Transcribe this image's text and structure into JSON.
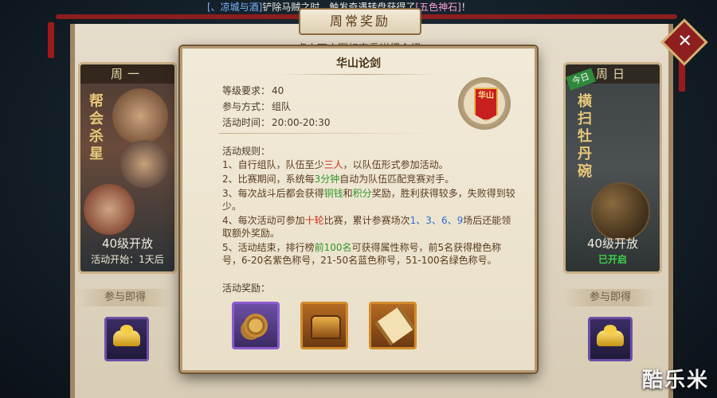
{
  "ticker": {
    "link": "[、凉城与酒]",
    "text": "铲除马贼之时，触发奇遇转盘获得了",
    "item": "[五色神石]",
    "end": "！"
  },
  "board": {
    "title": "周常奖励",
    "hint": "点击下方图标查看详细介绍",
    "close_label": "✕"
  },
  "left_card": {
    "day": "周一",
    "activity_vertical": "帮会杀星",
    "level": "40级开放",
    "sub": "活动开始：1天后",
    "join_label": "参与即得"
  },
  "right_card": {
    "badge": "今日",
    "day": "周日",
    "activity_vertical": "横扫牡丹碗",
    "level": "40级开放",
    "sub": "已开启",
    "join_label": "参与即得"
  },
  "dialog": {
    "title": "华山论剑",
    "level_key": "等级要求：",
    "level_val": "40",
    "mode_key": "参与方式：",
    "mode_val": "组队",
    "time_key": "活动时间：",
    "time_val": "20:00-20:30",
    "emblem_text": "华山",
    "rules_head": "活动规则：",
    "rules": {
      "r1a": "1、自行组队，队伍至少",
      "r1b": "三人",
      "r1c": "，以队伍形式参加活动。",
      "r2a": "2、比赛期间，系统每",
      "r2b": "3分钟",
      "r2c": "自动为队伍匹配竞赛对手。",
      "r3a": "3、每次战斗后都会获得",
      "r3b": "铜钱",
      "r3c": "和",
      "r3d": "积分",
      "r3e": "奖励，胜利获得较多，失败得到较少。",
      "r4a": "4、每次活动可参加",
      "r4b": "十轮",
      "r4c": "比赛，累计参赛场次",
      "r4d": "1、3、6、9",
      "r4e": "场后还能领取额外奖励。",
      "r5a": "5、活动结束，排行榜",
      "r5b": "前100名",
      "r5c": "可获得属性称号，前5名获得橙色称号，6-20名紫色称号，21-50名蓝色称号，51-100名绿色称号。"
    },
    "reward_head": "活动奖励："
  },
  "watermark": "酷乐米",
  "colors": {
    "accent_red": "#d22b1a",
    "accent_green": "#2f9a2b",
    "accent_blue": "#2f6fd0",
    "purple_frame": "#8b5bd2",
    "orange_frame": "#d28b2b"
  },
  "icons": {
    "coins": "copper-coins-icon",
    "chest": "treasure-chest-icon",
    "scroll": "title-scroll-icon",
    "ingot": "gold-ingot-icon",
    "emblem": "huashan-flag-icon"
  }
}
